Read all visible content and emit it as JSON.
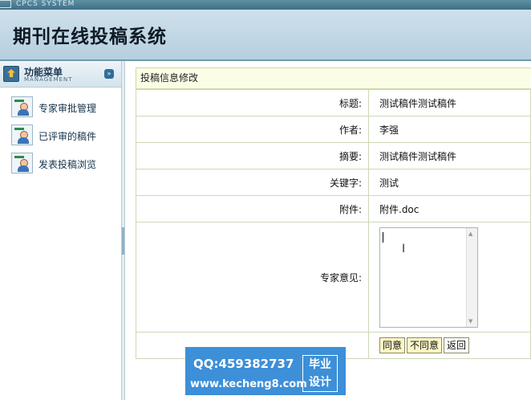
{
  "top_bar": {
    "text": "CPCS SYSTEM"
  },
  "header": {
    "title": "期刊在线投稿系统"
  },
  "sidebar": {
    "menu_title": "功能菜单",
    "menu_subtitle": "MANAGEMENT",
    "toggle_icon": "double-chevron-down-icon",
    "items": [
      {
        "label": "专家审批管理",
        "icon": "user-card-icon"
      },
      {
        "label": "已评审的稿件",
        "icon": "user-card-icon"
      },
      {
        "label": "发表投稿浏览",
        "icon": "user-card-icon"
      }
    ]
  },
  "form": {
    "title": "投稿信息修改",
    "fields": [
      {
        "label": "标题:",
        "value": "测试稿件测试稿件"
      },
      {
        "label": "作者:",
        "value": "李强"
      },
      {
        "label": "摘要:",
        "value": "测试稿件测试稿件"
      },
      {
        "label": "关键字:",
        "value": "测试"
      },
      {
        "label": "附件:",
        "value": "附件.doc"
      }
    ],
    "opinion_label": "专家意见:",
    "opinion_value": "",
    "buttons": {
      "agree": "同意",
      "disagree": "不同意",
      "back": "返回"
    }
  },
  "watermark": {
    "qq": "QQ:459382737",
    "url": "www.kecheng8.com",
    "badge": [
      "毕业",
      "设计"
    ]
  },
  "colors": {
    "header_bg": "#c4d9e7",
    "form_title_bg": "#fcfde6",
    "button_bg": "#fdf8c6",
    "watermark_bg": "#3d8fd8"
  }
}
